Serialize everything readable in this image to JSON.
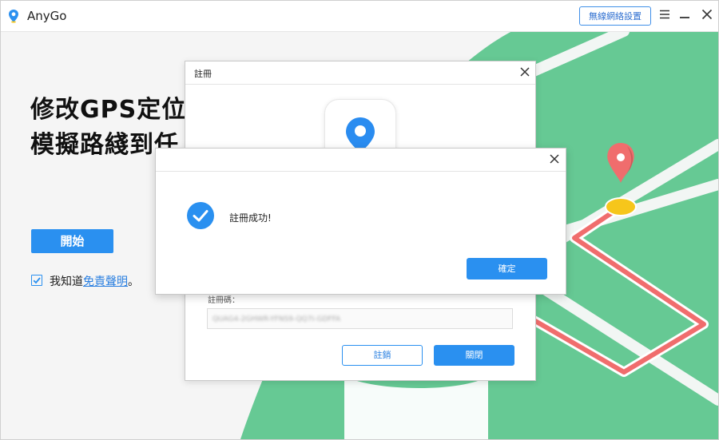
{
  "app": {
    "title": "AnyGo",
    "wifi_button": "無線網絡設置",
    "icons": [
      "map-pin-icon",
      "menu-icon",
      "minimize-icon",
      "close-icon"
    ]
  },
  "main": {
    "headline_line1": "修改GPS定位",
    "headline_line2": "模擬路綫到任",
    "start_button": "開始",
    "agreement_prefix": "我知道",
    "agreement_link": "免責聲明",
    "agreement_suffix": "。",
    "agreement_checked": true
  },
  "register_dialog": {
    "title": "註冊",
    "code_label": "註冊碼：",
    "code_value": "QUAG4-2GHWR-YFNS9-QQ7I-GDFFA",
    "deregister_button": "註銷",
    "close_button": "關閉"
  },
  "success_dialog": {
    "message": "註冊成功!",
    "confirm_button": "確定"
  },
  "colors": {
    "accent": "#2a90f0",
    "map_green": "#66c994",
    "route_red": "#f06d6d",
    "marker_yellow": "#f6c61b"
  }
}
